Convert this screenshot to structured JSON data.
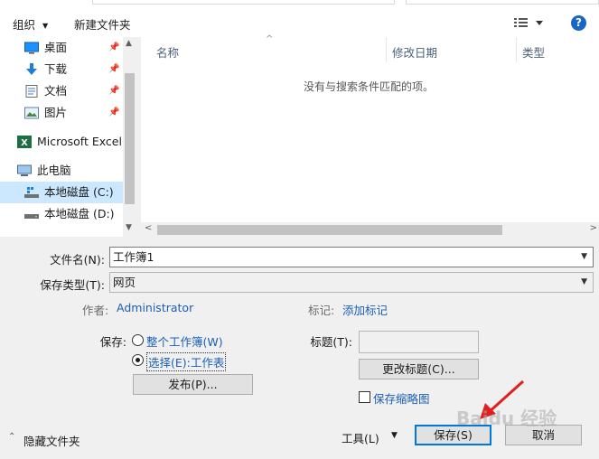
{
  "toolbar": {
    "organize": "组织",
    "new_folder": "新建文件夹",
    "help": "?"
  },
  "nav": [
    {
      "label": "桌面",
      "icon": "desktop-icon"
    },
    {
      "label": "下载",
      "icon": "download-icon"
    },
    {
      "label": "文档",
      "icon": "document-icon"
    },
    {
      "label": "图片",
      "icon": "picture-icon"
    },
    {
      "label": "Microsoft Excel",
      "icon": "excel-icon"
    },
    {
      "label": "此电脑",
      "icon": "computer-icon"
    },
    {
      "label": "本地磁盘 (C:)",
      "icon": "drive-c-icon",
      "selected": true
    },
    {
      "label": "本地磁盘 (D:)",
      "icon": "drive-d-icon"
    }
  ],
  "list": {
    "columns": [
      "名称",
      "修改日期",
      "类型"
    ],
    "empty_message": "没有与搜索条件匹配的项。"
  },
  "form": {
    "filename_label": "文件名(N):",
    "filename_value": "工作簿1",
    "filetype_label": "保存类型(T):",
    "filetype_value": "网页",
    "author_label": "作者:",
    "author_value": "Administrator",
    "tags_label": "标记:",
    "tags_value": "添加标记",
    "save_label": "保存:",
    "option_workbook": "整个工作簿(W)",
    "option_selection": "选择(E):工作表",
    "publish_button": "发布(P)...",
    "title_label": "标题(T):",
    "title_value": "",
    "change_title_button": "更改标题(C)...",
    "thumbnail_label": "保存缩略图"
  },
  "footer": {
    "hide_folders": "隐藏文件夹",
    "tools": "工具(L)",
    "save": "保存(S)",
    "cancel": "取消"
  },
  "colors": {
    "accent": "#0078d7",
    "link": "#1a5fb4",
    "selected": "#cce8ff"
  },
  "watermark": "Baidu 经验"
}
